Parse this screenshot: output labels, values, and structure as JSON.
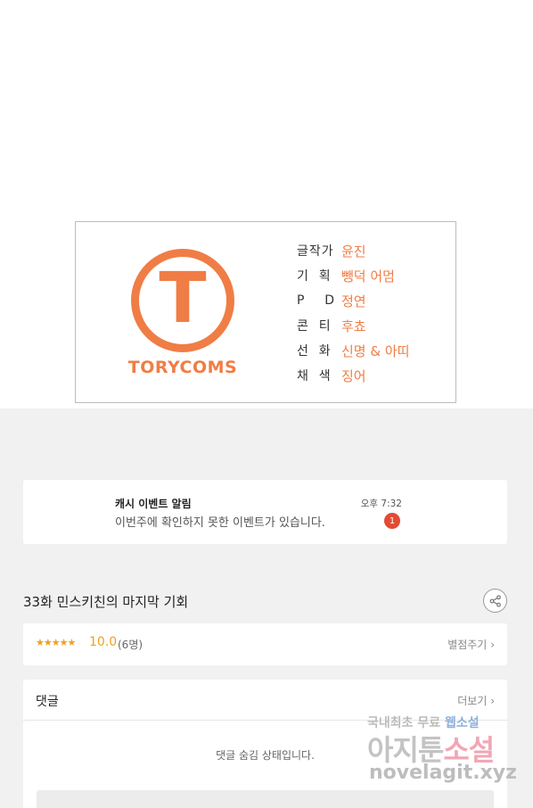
{
  "credits": {
    "logo_text": "TORYCOMS",
    "logo_letter": "T",
    "rows": [
      {
        "label": "글작가",
        "value": "윤진"
      },
      {
        "label": "기  획",
        "value": "뺑덕 어멈"
      },
      {
        "label": "P    D",
        "value": "정연"
      },
      {
        "label": "콘  티",
        "value": "후쵸"
      },
      {
        "label": "선  화",
        "value": "신명 & 아띠"
      },
      {
        "label": "채  색",
        "value": "징어"
      }
    ]
  },
  "notice": {
    "title": "캐시 이벤트 알림",
    "message": "이번주에 확인하지 못한 이벤트가 있습니다.",
    "time": "오후 7:32",
    "badge": "1"
  },
  "episode": {
    "title": "33화 민스키친의 마지막 기회"
  },
  "rating": {
    "stars": "★★★★★",
    "score": "10.0",
    "count": "(6명)",
    "rate_label": "별점주기"
  },
  "comments": {
    "title": "댓글",
    "more_label": "더보기",
    "hidden_message": "댓글 숨김 상태입니다."
  },
  "watermark": {
    "line1_a": "국내최초 무료 ",
    "line1_b": "웹소설",
    "line2_a": "아지툰",
    "line2_b": "소설",
    "line3": "novelagit.xyz"
  },
  "colors": {
    "brand_orange": "#f07d45",
    "star": "#f0a01e",
    "badge_red": "#e24b34"
  }
}
